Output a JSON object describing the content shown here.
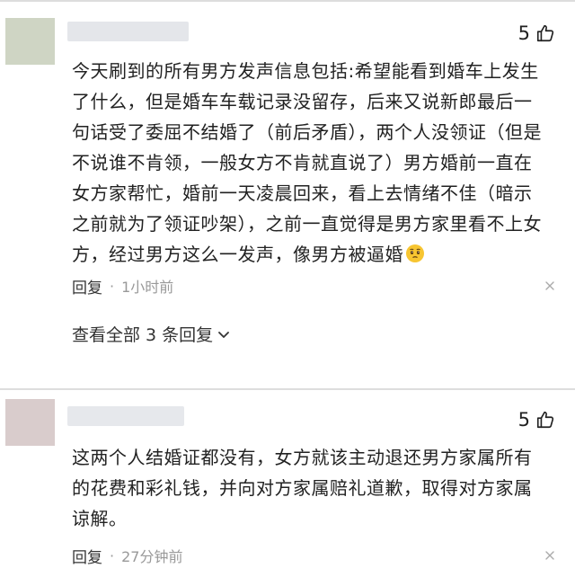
{
  "comments": [
    {
      "likes": "5",
      "text": "今天刷到的所有男方发声信息包括:希望能看到婚车上发生了什么，但是婚车车载记录没留存，后来又说新郎最后一句话受了委屈不结婚了（前后矛盾），两个人没领证（但是不说谁不肯领，一般女方不肯就直说了）男方婚前一直在女方家帮忙，婚前一天凌晨回来，看上去情绪不佳（暗示之前就为了领证吵架），之前一直觉得是男方家里看不上女方，经过男方这么一发声，像男方被逼婚",
      "reply_label": "回复",
      "separator": "·",
      "timestamp": "1小时前",
      "view_all_label": "查看全部 3 条回复",
      "avatar_color": "#cfd5c4",
      "username_color": "#e4e6ea"
    },
    {
      "likes": "5",
      "text": "这两个人结婚证都没有，女方就该主动退还男方家属所有的花费和彩礼钱，并向对方家属赔礼道歉，取得对方家属谅解。",
      "reply_label": "回复",
      "separator": "·",
      "timestamp": "27分钟前",
      "avatar_color": "#d9cccc",
      "username_color": "#e6e8ec"
    }
  ],
  "icons": {
    "like": "thumbs-up-outline-icon",
    "emoji": "pleading-face-emoji-icon",
    "close": "close-icon",
    "expand": "chevron-down-icon"
  },
  "colors": {
    "text_primary": "#222222",
    "text_secondary": "#999999",
    "divider": "#dddddd",
    "emoji_yellow": "#f7c531"
  }
}
